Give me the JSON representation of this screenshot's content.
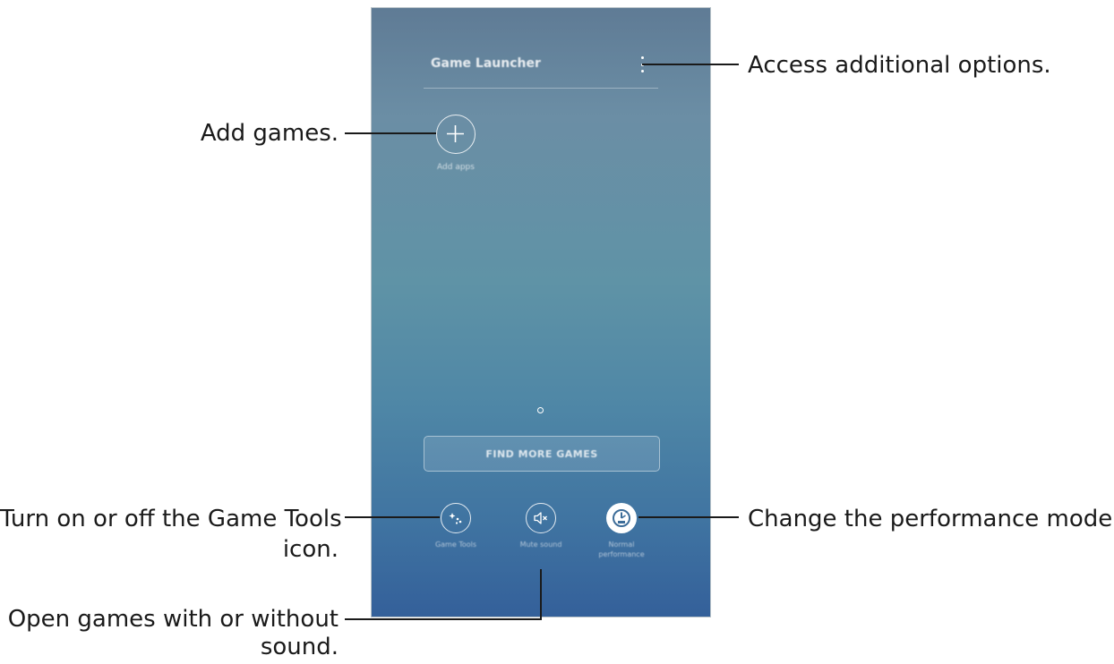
{
  "app": {
    "title": "Game Launcher",
    "add_label": "Add apps",
    "find_button": "FIND MORE GAMES"
  },
  "toolbar": [
    {
      "label": "Game Tools",
      "icon": "game-tools-icon"
    },
    {
      "label": "Mute sound",
      "icon": "mute-icon"
    },
    {
      "label": "Normal performance",
      "icon": "performance-icon"
    }
  ],
  "callouts": {
    "options": "Access additional options.",
    "add_games": "Add games.",
    "game_tools_line1": "Turn on or off the Game Tools",
    "game_tools_line2": "icon.",
    "performance": "Change the performance mode.",
    "sound_line1": "Open games with or without",
    "sound_line2": "sound."
  }
}
